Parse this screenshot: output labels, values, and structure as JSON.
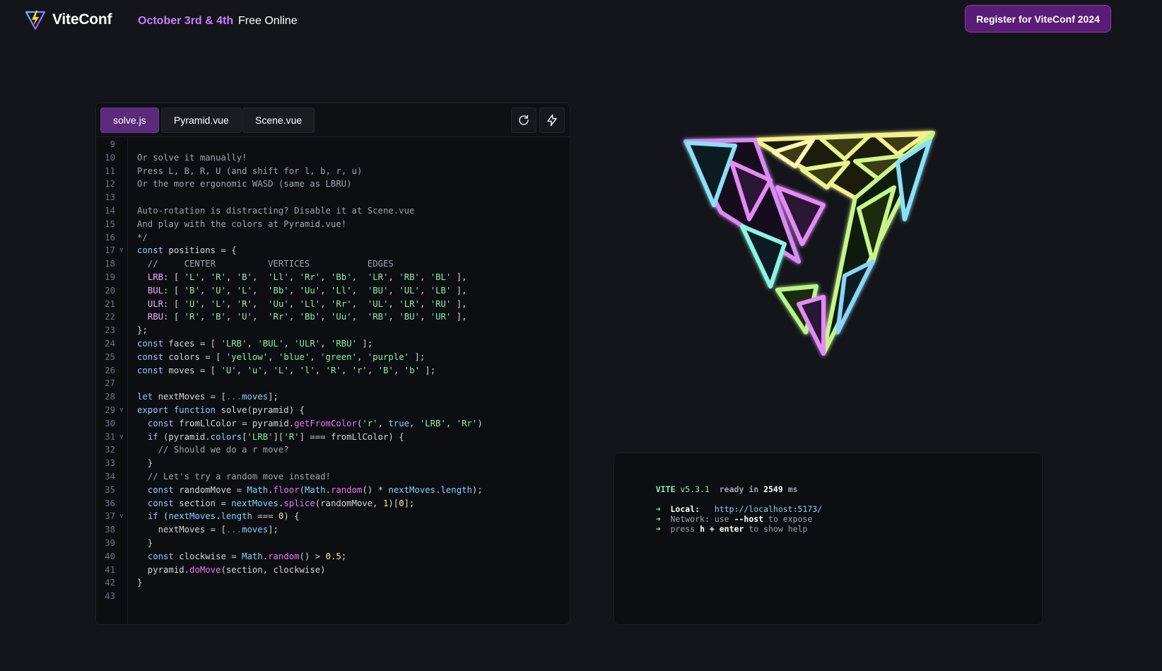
{
  "header": {
    "logo_text": "ViteConf",
    "dates": "October 3rd & 4th",
    "free_online": "Free Online",
    "register_label": "Register for ViteConf 2024"
  },
  "editor": {
    "tabs": [
      {
        "label": "solve.js",
        "active": true
      },
      {
        "label": "Pyramid.vue",
        "active": false
      },
      {
        "label": "Scene.vue",
        "active": false
      }
    ],
    "buttons": [
      "reload-icon",
      "bolt-icon"
    ],
    "lines": [
      {
        "n": "9",
        "text": ""
      },
      {
        "n": "10",
        "text": "Or solve it manually!"
      },
      {
        "n": "11",
        "text": "Press L, B, R, U (and shift for l, b, r, u)"
      },
      {
        "n": "12",
        "text": "Or the more ergonomic WASD (same as LBRU)"
      },
      {
        "n": "13",
        "text": ""
      },
      {
        "n": "14",
        "text": "Auto-rotation is distracting? Disable it at Scene.vue"
      },
      {
        "n": "15",
        "text": "And play with the colors at Pyramid.vue!"
      },
      {
        "n": "16",
        "text": "*/"
      },
      {
        "n": "17",
        "text": "const positions = {",
        "fold": true
      },
      {
        "n": "18",
        "text": "  //     CENTER          VERTICES           EDGES"
      },
      {
        "n": "19",
        "text": "  LRB: [ 'L', 'R', 'B',  'Ll', 'Rr', 'Bb',  'LR', 'RB', 'BL' ],"
      },
      {
        "n": "20",
        "text": "  BUL: [ 'B', 'U', 'L',  'Bb', 'Uu', 'Ll',  'BU', 'UL', 'LB' ],"
      },
      {
        "n": "21",
        "text": "  ULR: [ 'U', 'L', 'R',  'Uu', 'Ll', 'Rr',  'UL', 'LR', 'RU' ],"
      },
      {
        "n": "22",
        "text": "  RBU: [ 'R', 'B', 'U',  'Rr', 'Bb', 'Uu',  'RB', 'BU', 'UR' ],"
      },
      {
        "n": "23",
        "text": "};"
      },
      {
        "n": "24",
        "text": "const faces = [ 'LRB', 'BUL', 'ULR', 'RBU' ];"
      },
      {
        "n": "25",
        "text": "const colors = [ 'yellow', 'blue', 'green', 'purple' ];"
      },
      {
        "n": "26",
        "text": "const moves = [ 'U', 'u', 'L', 'l', 'R', 'r', 'B', 'b' ];"
      },
      {
        "n": "27",
        "text": ""
      },
      {
        "n": "28",
        "text": "let nextMoves = [...moves];"
      },
      {
        "n": "29",
        "text": "export function solve(pyramid) {",
        "fold": true
      },
      {
        "n": "30",
        "text": "  const fromLlColor = pyramid.getFromColor('r', true, 'LRB', 'Rr')"
      },
      {
        "n": "31",
        "text": "  if (pyramid.colors['LRB']['R'] === fromLlColor) {",
        "fold": true
      },
      {
        "n": "32",
        "text": "    // Should we do a r move?"
      },
      {
        "n": "33",
        "text": "  }"
      },
      {
        "n": "34",
        "text": "  // Let's try a random move instead!"
      },
      {
        "n": "35",
        "text": "  const randomMove = Math.floor(Math.random() * nextMoves.length);"
      },
      {
        "n": "36",
        "text": "  const section = nextMoves.splice(randomMove, 1)[0];"
      },
      {
        "n": "37",
        "text": "  if (nextMoves.length === 0) {",
        "fold": true
      },
      {
        "n": "38",
        "text": "    nextMoves = [...moves];"
      },
      {
        "n": "39",
        "text": "  }"
      },
      {
        "n": "40",
        "text": "  const clockwise = Math.random() > 0.5;"
      },
      {
        "n": "41",
        "text": "  pyramid.doMove(section, clockwise)"
      },
      {
        "n": "42",
        "text": "}"
      },
      {
        "n": "43",
        "text": ""
      }
    ]
  },
  "terminal": {
    "vite": "VITE",
    "version": "v5.3.1",
    "ready_prefix": "ready in",
    "ready_ms": "2549",
    "ready_unit": "ms",
    "arrow": "➜",
    "local_label": "Local:",
    "local_url": "http://localhost:5173/",
    "network_label": "Network:",
    "network_use": "use",
    "network_flag": "--host",
    "network_suffix": "to expose",
    "help_press": "press",
    "help_keys": "h + enter",
    "help_suffix": "to show help"
  }
}
